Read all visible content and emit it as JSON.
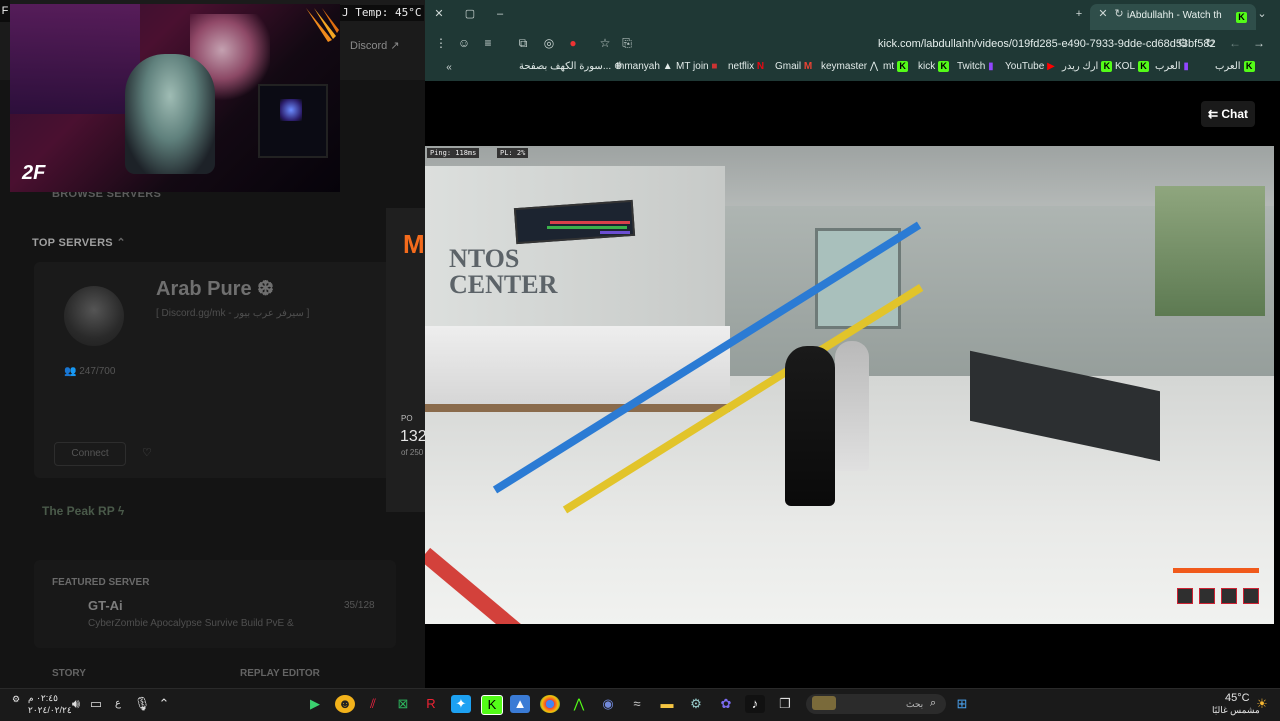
{
  "overlay": {
    "f_tag": "F",
    "temp": "J Temp: 45°C"
  },
  "bg_app": {
    "discord": "Discord",
    "browse_servers": "BROWSE SERVERS",
    "top_servers": "TOP SERVERS",
    "server_name": "Arab Pure ❆",
    "server_sub": "[ Discord.gg/mk - سيرفر عرب بيور ]",
    "players": "247/700",
    "connect": "Connect",
    "peak": "The Peak RP ϟ",
    "featured_label": "FEATURED SERVER",
    "featured_name": "GT-Ai",
    "featured_sub": "CyberZombie Apocalypse Survive Build PvE &",
    "featured_count": "35/128",
    "story": "STORY",
    "replay": "REPLAY EDITOR",
    "popup_logo": "M",
    "popup_label": "PO",
    "popup_number": "132",
    "popup_of": "of 250"
  },
  "browser": {
    "tab_title": "iAbdullahh - Watch the VOD",
    "url": "kick.com/labdullahh/videos/019fd285-e490-7933-9dde-cd68d53bf582",
    "bookmarks": [
      "العرب",
      "العرب",
      "KOL",
      "ارك ريدر",
      "YouTube",
      "Twitch",
      "kick",
      "mt",
      "keymaster",
      "Gmail",
      "netflix",
      "MT join",
      "thmanyah",
      "سورة الكهف بصفحة..."
    ],
    "chat_button": "Chat"
  },
  "video": {
    "sign": "NTOS\nCENTER",
    "ping": "Ping: 118ms",
    "pl": "PL: 2%"
  },
  "taskbar": {
    "weather_temp": "45°C",
    "weather_desc": "مشمس غالبًا",
    "search_placeholder": "بحث",
    "time": "٠٢:٤٥ م",
    "date": "٢٠٢٤/٠٢/٢٤",
    "lang": "ع"
  }
}
